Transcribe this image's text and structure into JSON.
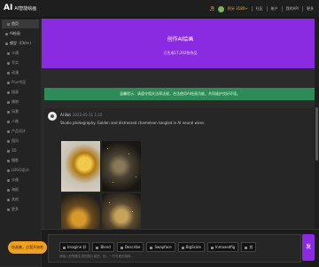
{
  "app": {
    "logo": "AI",
    "logo_sub": "AI智能绘画",
    "top_nav": {
      "points": "积分 3180+",
      "items": [
        "社区",
        "账户",
        "我的API",
        "更多"
      ],
      "bell_icon": "bell-icon",
      "avatar_icon": "avatar-icon"
    }
  },
  "sidebar": {
    "items": [
      {
        "label": "首页",
        "active": true,
        "group": false
      },
      {
        "label": "AI绘画",
        "active": false,
        "group": true
      },
      {
        "label": "模型（Ctrl+）",
        "active": false,
        "group": true
      },
      {
        "label": "卡通",
        "active": false,
        "group": false
      },
      {
        "label": "写实",
        "active": false,
        "group": false
      },
      {
        "label": "动漫",
        "active": false,
        "group": false
      },
      {
        "label": "Flux专区",
        "active": false,
        "group": false
      },
      {
        "label": "插画",
        "active": false,
        "group": false
      },
      {
        "label": "建筑",
        "active": false,
        "group": false
      },
      {
        "label": "风景",
        "active": false,
        "group": false
      },
      {
        "label": "人像",
        "active": false,
        "group": false
      },
      {
        "label": "产品设计",
        "active": false,
        "group": false
      },
      {
        "label": "国风",
        "active": false,
        "group": false
      },
      {
        "label": "3D",
        "active": false,
        "group": false
      },
      {
        "label": "摄影",
        "active": false,
        "group": false
      },
      {
        "label": "LOGO设计",
        "active": false,
        "group": false
      },
      {
        "label": "头像",
        "active": false,
        "group": false
      },
      {
        "label": "海报",
        "active": false,
        "group": false
      },
      {
        "label": "其他",
        "active": false,
        "group": false
      },
      {
        "label": "更多",
        "active": false,
        "group": false
      }
    ]
  },
  "hero": {
    "title": "创作AI绘画",
    "subtitle": "已生成17,202张作品"
  },
  "notice": {
    "text": "温馨提示：请遵守相关法律法规，合法使用AI绘画功能，共同维护良好环境。"
  },
  "message": {
    "author": "AI Bot",
    "time": "2023-05-11 1:10",
    "prompt": "Studio photography. Golden and distressed chameleon tangled in AI neural wires.",
    "images": [
      "chameleon-image-1",
      "chameleon-image-2",
      "chameleon-image-3",
      "chameleon-image-4"
    ]
  },
  "composer": {
    "chips": [
      "Imagine 好",
      "Blend",
      "Describe",
      "Swapface",
      "BigScale",
      "Inmaxedfig",
      "其"
    ],
    "placeholder": "请输入您想要生成的图片描述，如：一只可爱的猫咪...",
    "send_label": "发"
  },
  "floating_tip": {
    "text": "绘画集，点我开始吧"
  },
  "colors": {
    "hero": "#8a2be2",
    "notice": "#2e8b57",
    "tip": "#f0a020"
  }
}
